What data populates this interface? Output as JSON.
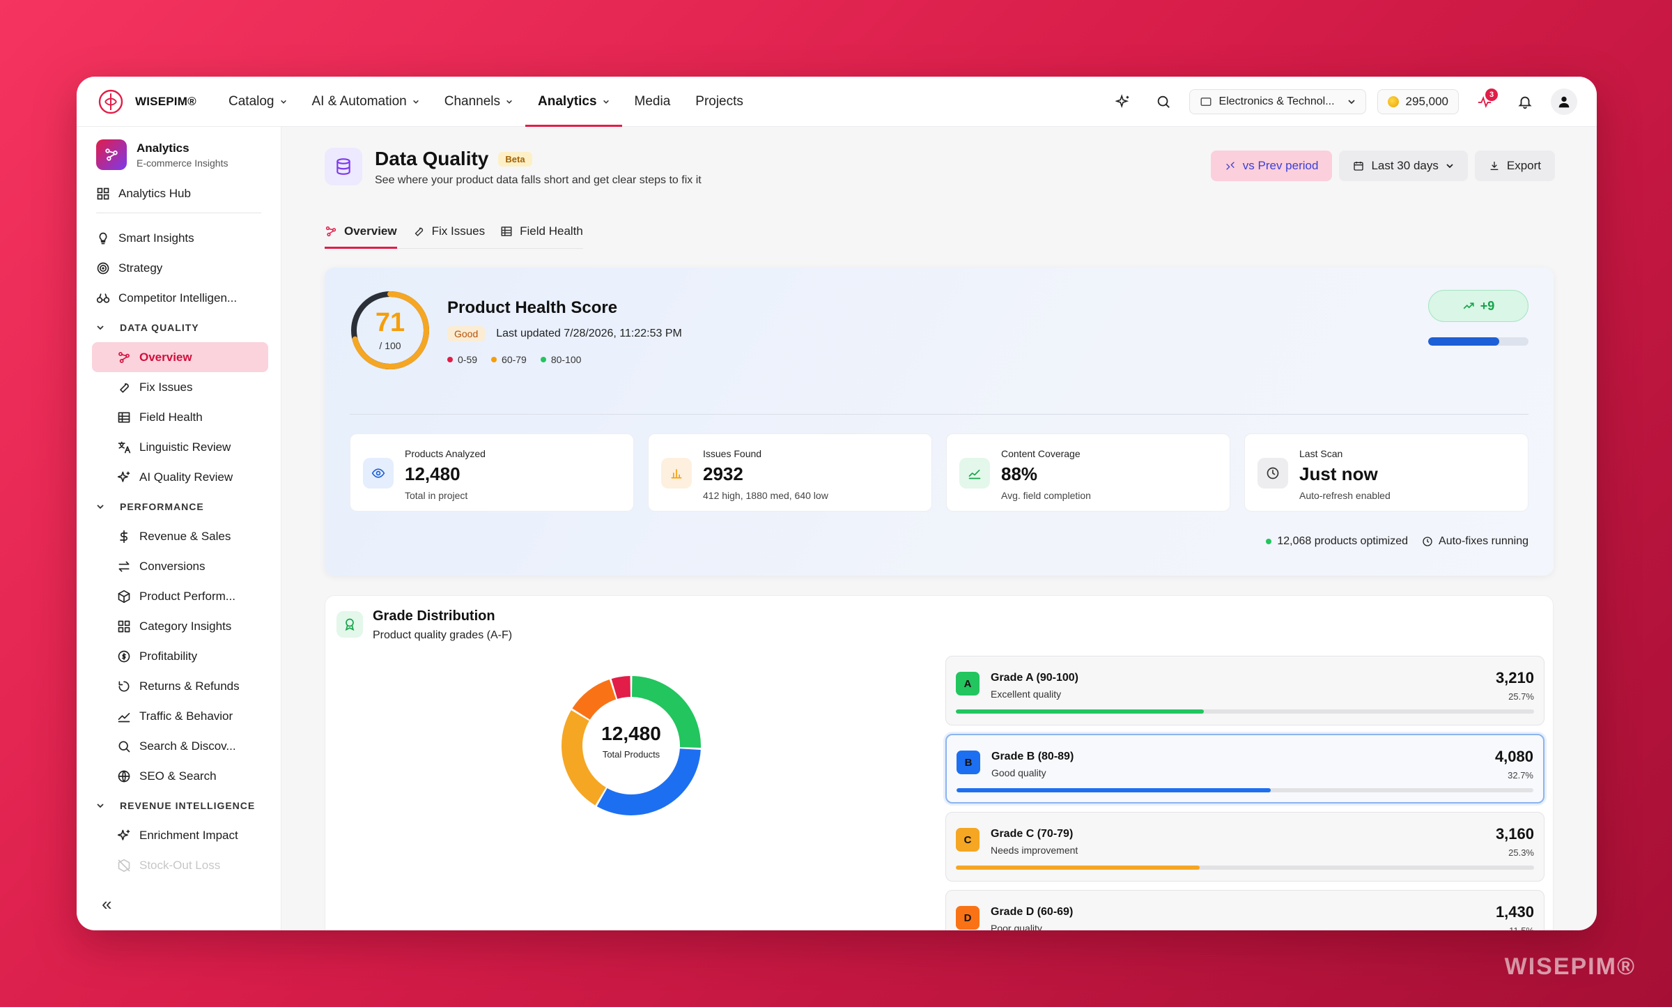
{
  "brand": {
    "name": "WISEPIM®",
    "watermark": "WISEPIM®"
  },
  "nav": [
    {
      "label": "Catalog",
      "dropdown": true
    },
    {
      "label": "AI & Automation",
      "dropdown": true
    },
    {
      "label": "Channels",
      "dropdown": true
    },
    {
      "label": "Analytics",
      "dropdown": true,
      "active": true
    },
    {
      "label": "Media",
      "dropdown": false
    },
    {
      "label": "Projects",
      "dropdown": false
    }
  ],
  "toolbar": {
    "store": "Electronics & Technol...",
    "credits": "295,000",
    "alerts_count": "3"
  },
  "sidebar": {
    "app_title": "Analytics",
    "app_subtitle": "E-commerce Insights",
    "hub": "Analytics Hub",
    "top_items": [
      {
        "label": "Smart Insights",
        "icon": "bulb-icon"
      },
      {
        "label": "Strategy",
        "icon": "target-icon"
      },
      {
        "label": "Competitor Intelligen...",
        "icon": "binoculars-icon"
      }
    ],
    "sections": [
      {
        "title": "DATA QUALITY",
        "items": [
          {
            "label": "Overview",
            "icon": "overview-icon",
            "active": true
          },
          {
            "label": "Fix Issues",
            "icon": "wrench-icon"
          },
          {
            "label": "Field Health",
            "icon": "table-icon"
          },
          {
            "label": "Linguistic Review",
            "icon": "translate-icon"
          },
          {
            "label": "AI Quality Review",
            "icon": "sparkle-icon"
          }
        ]
      },
      {
        "title": "PERFORMANCE",
        "items": [
          {
            "label": "Revenue & Sales",
            "icon": "dollar-icon"
          },
          {
            "label": "Conversions",
            "icon": "arrows-icon"
          },
          {
            "label": "Product Perform...",
            "icon": "box-icon"
          },
          {
            "label": "Category Insights",
            "icon": "grid-icon"
          },
          {
            "label": "Profitability",
            "icon": "coin-icon"
          },
          {
            "label": "Returns & Refunds",
            "icon": "return-icon"
          },
          {
            "label": "Traffic & Behavior",
            "icon": "trend-icon"
          },
          {
            "label": "Search & Discov...",
            "icon": "search-icon"
          },
          {
            "label": "SEO & Search",
            "icon": "globe-icon"
          }
        ]
      },
      {
        "title": "REVENUE INTELLIGENCE",
        "items": [
          {
            "label": "Enrichment Impact",
            "icon": "sparkle-icon"
          },
          {
            "label": "Stock-Out Loss",
            "icon": "box-off-icon"
          }
        ]
      }
    ],
    "collapse": "«"
  },
  "page": {
    "title": "Data Quality",
    "badge": "Beta",
    "subtitle": "See where your product data falls short and get clear steps to fix it",
    "compare_btn": "vs Prev period",
    "range_btn": "Last 30 days",
    "export_btn": "Export",
    "tabs": [
      {
        "label": "Overview",
        "active": true
      },
      {
        "label": "Fix Issues"
      },
      {
        "label": "Field Health"
      }
    ]
  },
  "health": {
    "score": "71",
    "score_max": "/ 100",
    "score_value": 71,
    "title": "Product Health Score",
    "status": "Good",
    "updated": "Last updated 7/28/2026, 11:22:53 PM",
    "legend": [
      {
        "label": "0-59",
        "color": "#e11d48"
      },
      {
        "label": "60-79",
        "color": "#f59e0b"
      },
      {
        "label": "80-100",
        "color": "#22c55e"
      }
    ],
    "delta": "+9",
    "progress": 0.71,
    "stats": [
      {
        "label": "Products Analyzed",
        "value": "12,480",
        "sub": "Total in project",
        "icon": "eye-icon",
        "bg": "#e5eefc",
        "fg": "#1d5fd6"
      },
      {
        "label": "Issues Found",
        "value": "2932",
        "sub": "412 high, 1880 med, 640 low",
        "icon": "bars-icon",
        "bg": "#fdf0df",
        "fg": "#f59e0b"
      },
      {
        "label": "Content Coverage",
        "value": "88%",
        "sub": "Avg. field completion",
        "icon": "chart-icon",
        "bg": "#e3f7ea",
        "fg": "#16a34a"
      },
      {
        "label": "Last Scan",
        "value": "Just now",
        "sub": "Auto-refresh enabled",
        "icon": "clock-icon",
        "bg": "#ededef",
        "fg": "#333"
      }
    ],
    "optimized": "12,068 products optimized",
    "autofix": "Auto-fixes running"
  },
  "grades": {
    "title": "Grade Distribution",
    "subtitle": "Product quality grades (A-F)",
    "total": "12,480",
    "total_label": "Total Products",
    "items": [
      {
        "letter": "A",
        "name": "Grade A (90-100)",
        "quality": "Excellent quality",
        "count": "3,210",
        "pct": "25.7%",
        "share": 0.257,
        "color": "#22c55e"
      },
      {
        "letter": "B",
        "name": "Grade B (80-89)",
        "quality": "Good quality",
        "count": "4,080",
        "pct": "32.7%",
        "share": 0.327,
        "color": "#1d6ff2",
        "selected": true
      },
      {
        "letter": "C",
        "name": "Grade C (70-79)",
        "quality": "Needs improvement",
        "count": "3,160",
        "pct": "25.3%",
        "share": 0.253,
        "color": "#f5a623"
      },
      {
        "letter": "D",
        "name": "Grade D (60-69)",
        "quality": "Poor quality",
        "count": "1,430",
        "pct": "11.5%",
        "share": 0.115,
        "color": "#f97316"
      }
    ],
    "chart_data": {
      "type": "pie",
      "categories": [
        "A",
        "B",
        "C",
        "D",
        "F"
      ],
      "values": [
        3210,
        4080,
        3160,
        1430,
        600
      ],
      "colors": [
        "#22c55e",
        "#1d6ff2",
        "#f5a623",
        "#f97316",
        "#e11d48"
      ]
    }
  }
}
